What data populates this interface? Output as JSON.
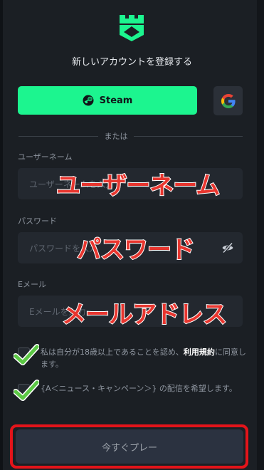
{
  "page": {
    "title": "新しいアカウントを登録する",
    "or_text": "または",
    "colors": {
      "accent": "#1cf58f",
      "background": "#1b1f24",
      "overlay_red": "#e8362f",
      "highlight": "#e3141a"
    }
  },
  "social": {
    "steam_label": "Steam",
    "google_icon": "google-icon"
  },
  "form": {
    "username": {
      "label": "ユーザーネーム",
      "placeholder": "ユーザーネームを入力"
    },
    "password": {
      "label": "パスワード",
      "placeholder": "パスワードを入力"
    },
    "email": {
      "label": "Eメール",
      "placeholder": "Eメールを入力"
    }
  },
  "overlays": {
    "username": "ユーザーネーム",
    "password": "パスワード",
    "email": "メールアドレス"
  },
  "checks": {
    "age_pre": "私は自分が18歳以上であることを認め、",
    "age_link": "利用規約",
    "age_post": "に同意します。",
    "news": "{A＜ニュース・キャンペーン＞} の配信を希望します。"
  },
  "submit_label": "今すぐプレー"
}
